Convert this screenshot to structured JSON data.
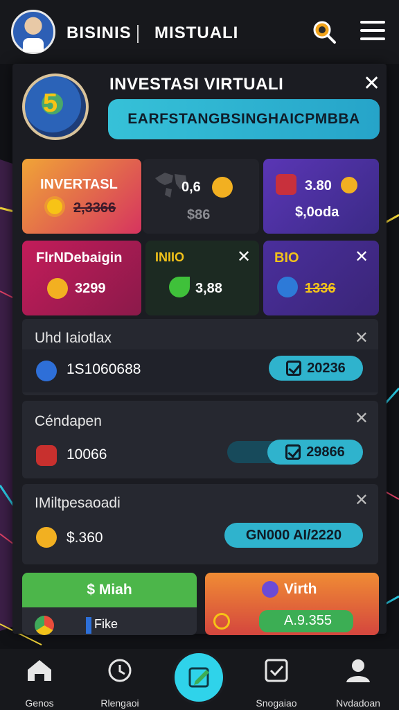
{
  "app": {
    "title": "BISINIS",
    "subtitle": "MISTUALI"
  },
  "header": {
    "title": "INVESTASI VIRTUALI",
    "code": "EARFSTANGBSINGHAICPMBBA",
    "logo_text": ""
  },
  "tiles": [
    {
      "title": "INVERTASL",
      "value": "2,3366"
    },
    {
      "title": "0,6",
      "value": "$86"
    },
    {
      "title": "3.80",
      "value": "$,0oda"
    },
    {
      "title": "FlrNDebaigin",
      "value": "3299"
    },
    {
      "title": "INIIO",
      "value": "3,88"
    },
    {
      "title": "BIO",
      "value": "1336"
    }
  ],
  "list": [
    {
      "title": "Uhd Iaiotlax",
      "value": "1S1060688",
      "badge": "20236"
    },
    {
      "title": "Céndapen",
      "value": "10066",
      "badge": "29866"
    },
    {
      "title": "IMiltpesaoadi",
      "value": "$.360",
      "badge": "GN000 AI/2220"
    }
  ],
  "bottom_cards": [
    {
      "title": "$ Miah",
      "sub": "Fike"
    },
    {
      "title": "Virth",
      "sub": "A.9.355"
    }
  ],
  "nav": [
    {
      "label": "Genos",
      "icon": "home-icon"
    },
    {
      "label": "Rlengaoi",
      "icon": "clock-icon"
    },
    {
      "label": "",
      "icon": "edit-icon"
    },
    {
      "label": "Snogaiao",
      "icon": "checkbox-icon"
    },
    {
      "label": "Nvdadoan",
      "icon": "user-icon"
    }
  ],
  "colors": {
    "accent": "#2fb3cd",
    "bg": "#111216",
    "panel": "#1b1c22"
  }
}
